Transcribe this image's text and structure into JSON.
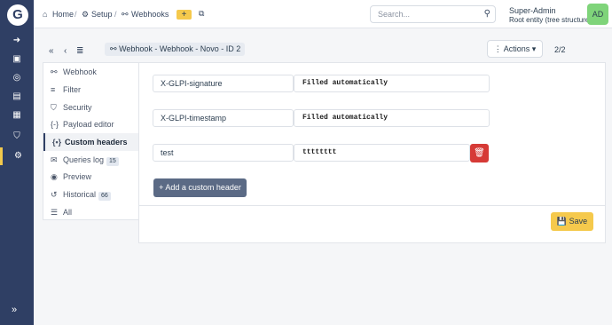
{
  "sidebar": {
    "logo": "G",
    "items": [
      {
        "icon": "sign-in-icon",
        "glyph": "➜"
      },
      {
        "icon": "box-icon",
        "glyph": "▣"
      },
      {
        "icon": "headset-icon",
        "glyph": "◎"
      },
      {
        "icon": "file-icon",
        "glyph": "▤"
      },
      {
        "icon": "briefcase-icon",
        "glyph": "▦"
      },
      {
        "icon": "shield-icon",
        "glyph": "⛉"
      },
      {
        "icon": "gear-icon",
        "glyph": "⚙"
      }
    ],
    "collapse_glyph": "»"
  },
  "breadcrumb": {
    "home": "Home",
    "setup": "Setup",
    "webhooks": "Webhooks",
    "home_glyph": "⌂",
    "setup_glyph": "⚙",
    "webhooks_glyph": "⚯",
    "sep": "/",
    "add_glyph": "+",
    "external_glyph": "⧉"
  },
  "search": {
    "placeholder": "Search...",
    "icon_glyph": "⚲"
  },
  "user": {
    "name": "Super-Admin",
    "entity": "Root entity (tree structure)",
    "initials": "AD"
  },
  "toolbar": {
    "first_glyph": "«",
    "prev_glyph": "‹",
    "list_glyph": "≣",
    "title_glyph": "⚯",
    "title": "Webhook - Webhook - Novo - ID 2",
    "actions": "⋮ Actions ▾",
    "pager": "2/2"
  },
  "tabs": [
    {
      "label": "Webhook",
      "glyph": "⚯"
    },
    {
      "label": "Filter",
      "glyph": "≡"
    },
    {
      "label": "Security",
      "glyph": "⛉"
    },
    {
      "label": "Payload editor",
      "glyph": "{-}"
    },
    {
      "label": "Custom headers",
      "glyph": "{•}",
      "active": true
    },
    {
      "label": "Queries log",
      "glyph": "✉",
      "badge": "15"
    },
    {
      "label": "Preview",
      "glyph": "◉"
    },
    {
      "label": "Historical",
      "glyph": "↺",
      "badge": "66"
    },
    {
      "label": "All",
      "glyph": "☰"
    }
  ],
  "headers": [
    {
      "name": "X-GLPI-signature",
      "value": "Filled automatically"
    },
    {
      "name": "X-GLPI-timestamp",
      "value": "Filled automatically"
    },
    {
      "name": "test",
      "value": "tttttttt"
    }
  ],
  "buttons": {
    "delete_glyph": "🗑",
    "add_header": "+ Add a custom header",
    "save": "💾 Save"
  },
  "colors": {
    "sidebar": "#2f3f64",
    "accent": "#f5c94c",
    "danger": "#d63a36",
    "avatar": "#7fd47a"
  }
}
